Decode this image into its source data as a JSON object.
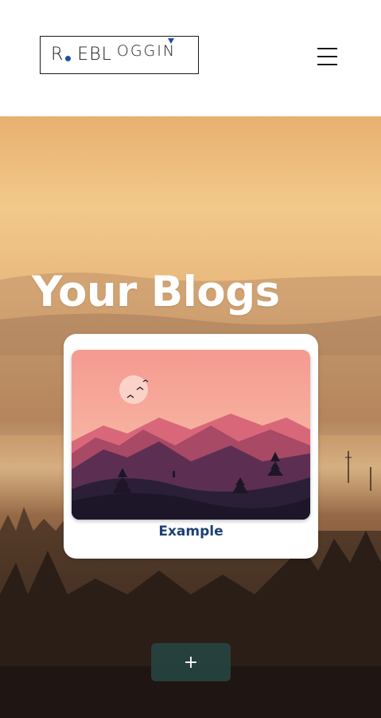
{
  "header": {
    "logo": {
      "parts": [
        "R",
        "EBL",
        "OGGIN"
      ]
    },
    "menu_icon": "hamburger-menu-icon"
  },
  "hero": {
    "title": "Your Blogs"
  },
  "blogs": [
    {
      "title": "Example",
      "thumbnail": "sunset-mountains-illustration"
    }
  ],
  "actions": {
    "add_label": "+"
  },
  "colors": {
    "accent_blue": "#1f4fa6",
    "card_title": "#1e4172",
    "add_button": "#264644"
  }
}
